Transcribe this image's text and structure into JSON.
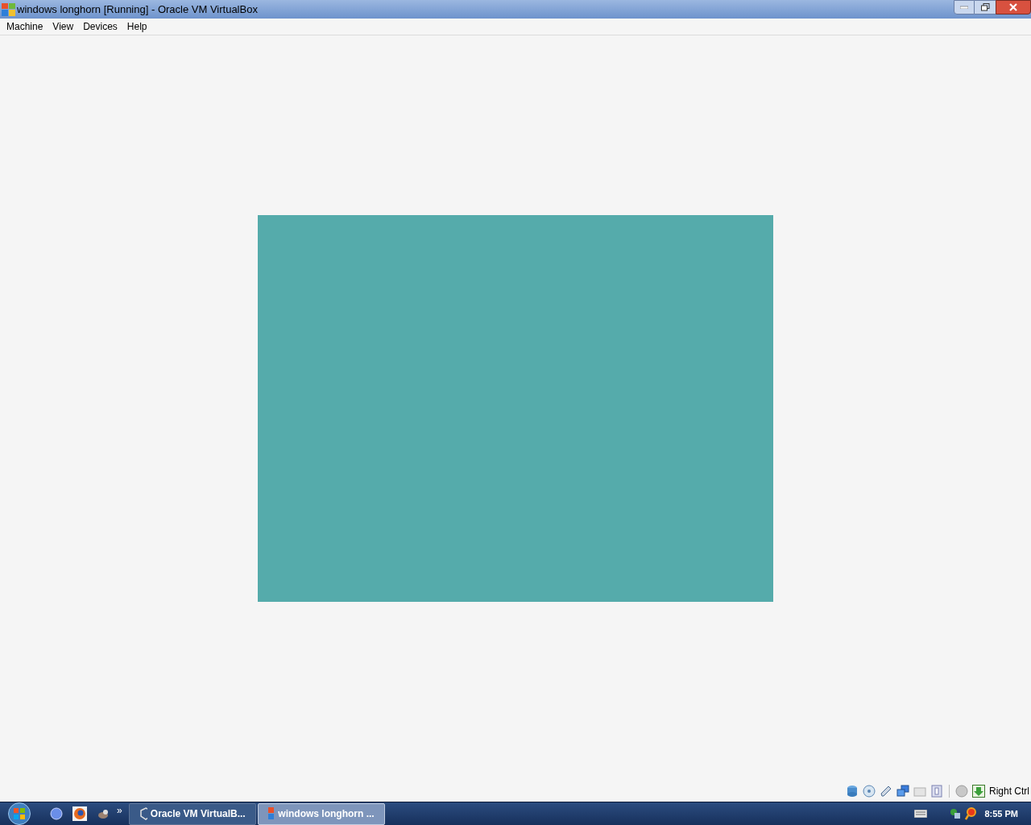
{
  "window": {
    "title": "windows longhorn [Running] - Oracle VM VirtualBox"
  },
  "menu": [
    "Machine",
    "View",
    "Devices",
    "Help"
  ],
  "status_bar": {
    "host_key": "Right Ctrl"
  },
  "taskbar": {
    "overflow": "»",
    "buttons": [
      {
        "label": "Oracle VM VirtualB...",
        "selected": false
      },
      {
        "label": "windows longhorn ...",
        "selected": true
      }
    ],
    "clock": "8:55 PM"
  }
}
